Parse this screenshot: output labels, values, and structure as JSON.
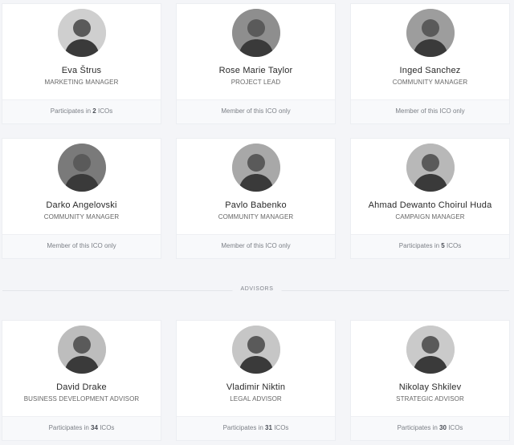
{
  "team": [
    {
      "name": "Eva Štrus",
      "role": "MARKETING MANAGER",
      "foot_prefix": "Participates in",
      "foot_count": "2",
      "foot_suffix": "ICOs",
      "tone": "#cfcfcf"
    },
    {
      "name": "Rose Marie Taylor",
      "role": "PROJECT LEAD",
      "foot_prefix": "Member of this ICO only",
      "foot_count": "",
      "foot_suffix": "",
      "tone": "#8e8e8e"
    },
    {
      "name": "Inged Sanchez",
      "role": "COMMUNITY MANAGER",
      "foot_prefix": "Member of this ICO only",
      "foot_count": "",
      "foot_suffix": "",
      "tone": "#9d9d9d"
    },
    {
      "name": "Darko Angelovski",
      "role": "COMMUNITY MANAGER",
      "foot_prefix": "Member of this ICO only",
      "foot_count": "",
      "foot_suffix": "",
      "tone": "#7a7a7a"
    },
    {
      "name": "Pavlo Babenko",
      "role": "COMMUNITY MANAGER",
      "foot_prefix": "Member of this ICO only",
      "foot_count": "",
      "foot_suffix": "",
      "tone": "#a8a8a8"
    },
    {
      "name": "Ahmad Dewanto Choirul Huda",
      "role": "CAMPAIGN MANAGER",
      "foot_prefix": "Participates in",
      "foot_count": "5",
      "foot_suffix": "ICOs",
      "tone": "#b8b8b8"
    }
  ],
  "divider": {
    "label": "ADVISORS"
  },
  "advisors": [
    {
      "name": "David Drake",
      "role": "BUSINESS DEVELOPMENT ADVISOR",
      "foot_prefix": "Participates in",
      "foot_count": "34",
      "foot_suffix": "ICOs",
      "tone": "#bdbdbd"
    },
    {
      "name": "Vladimir Niktin",
      "role": "LEGAL ADVISOR",
      "foot_prefix": "Participates in",
      "foot_count": "31",
      "foot_suffix": "ICOs",
      "tone": "#c6c6c6"
    },
    {
      "name": "Nikolay Shkilev",
      "role": "STRATEGIC ADVISOR",
      "foot_prefix": "Participates in",
      "foot_count": "30",
      "foot_suffix": "ICOs",
      "tone": "#cacaca"
    }
  ]
}
